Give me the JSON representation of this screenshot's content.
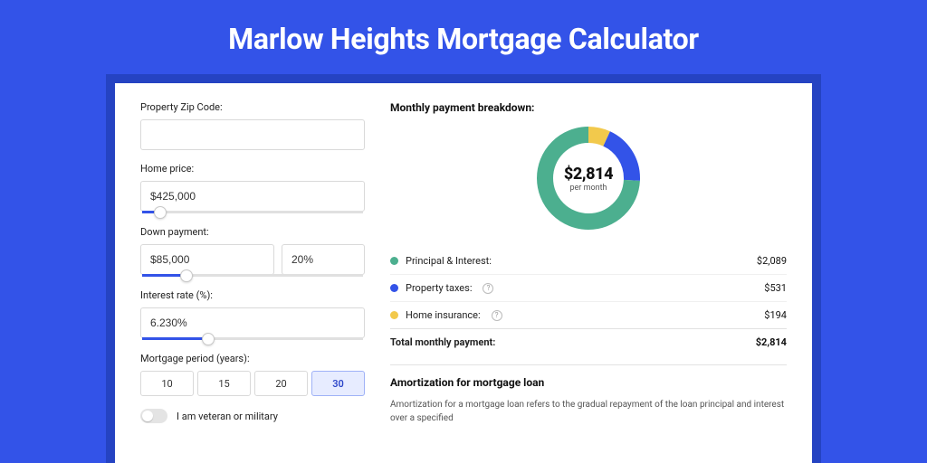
{
  "title": "Marlow Heights Mortgage Calculator",
  "form": {
    "zip_label": "Property Zip Code:",
    "zip_value": "",
    "home_price_label": "Home price:",
    "home_price_value": "$425,000",
    "home_price_slider_pct": 8,
    "down_payment_label": "Down payment:",
    "down_payment_value": "$85,000",
    "down_payment_pct": "20%",
    "down_payment_slider_pct": 20,
    "interest_label": "Interest rate (%):",
    "interest_value": "6.230%",
    "interest_slider_pct": 30,
    "period_label": "Mortgage period (years):",
    "period_options": [
      "10",
      "15",
      "20",
      "30"
    ],
    "period_selected": "30",
    "veteran_label": "I am veteran or military",
    "veteran_on": false
  },
  "breakdown": {
    "title": "Monthly payment breakdown:",
    "center_amount": "$2,814",
    "center_label": "per month",
    "items": [
      {
        "label": "Principal & Interest:",
        "value": "$2,089",
        "num": 2089,
        "color": "#4caf8f",
        "help": false
      },
      {
        "label": "Property taxes:",
        "value": "$531",
        "num": 531,
        "color": "#3353e8",
        "help": true
      },
      {
        "label": "Home insurance:",
        "value": "$194",
        "num": 194,
        "color": "#f2c94c",
        "help": true
      }
    ],
    "total_label": "Total monthly payment:",
    "total_value": "$2,814"
  },
  "chart_data": {
    "type": "pie",
    "title": "Monthly payment breakdown",
    "series": [
      {
        "name": "Principal & Interest",
        "value": 2089,
        "color": "#4caf8f"
      },
      {
        "name": "Property taxes",
        "value": 531,
        "color": "#3353e8"
      },
      {
        "name": "Home insurance",
        "value": 194,
        "color": "#f2c94c"
      }
    ],
    "total": 2814,
    "center_label": "per month"
  },
  "amortization": {
    "title": "Amortization for mortgage loan",
    "text": "Amortization for a mortgage loan refers to the gradual repayment of the loan principal and interest over a specified"
  }
}
